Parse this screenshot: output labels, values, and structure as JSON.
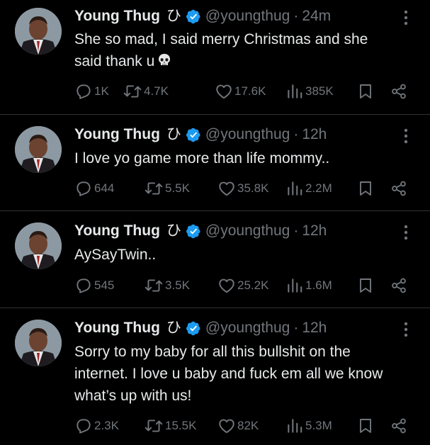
{
  "tweets": [
    {
      "name": "Young Thug",
      "name_glyph": "ひ",
      "handle": "@youngthug",
      "separator": "·",
      "time": "24m",
      "text_lines": [
        "She so mad, I said merry Christmas and she",
        "said thank u"
      ],
      "emoji": "skull-emoji",
      "replies": "1K",
      "reposts": "4.7K",
      "likes": "17.6K",
      "views": "385K"
    },
    {
      "name": "Young Thug",
      "name_glyph": "ひ",
      "handle": "@youngthug",
      "separator": "·",
      "time": "12h",
      "text_lines": [
        "I love yo game more than life mommy.."
      ],
      "replies": "644",
      "reposts": "5.5K",
      "likes": "35.8K",
      "views": "2.2M"
    },
    {
      "name": "Young Thug",
      "name_glyph": "ひ",
      "handle": "@youngthug",
      "separator": "·",
      "time": "12h",
      "text_lines": [
        "AySayTwin.."
      ],
      "replies": "545",
      "reposts": "3.5K",
      "likes": "25.2K",
      "views": "1.6M"
    },
    {
      "name": "Young Thug",
      "name_glyph": "ひ",
      "handle": "@youngthug",
      "separator": "·",
      "time": "12h",
      "text_lines": [
        "Sorry to my baby for all this bullshit on the",
        "internet. I love u baby and fuck em all we know",
        "what’s up with us!"
      ],
      "replies": "2.3K",
      "reposts": "15.5K",
      "likes": "82K",
      "views": "5.3M"
    }
  ],
  "colors": {
    "background": "#000000",
    "text": "#e7e9ea",
    "muted": "#71767b",
    "verified": "#1d9bf0",
    "divider": "#2f3336"
  },
  "icons": {
    "reply": "reply-icon",
    "repost": "repost-icon",
    "like": "heart-icon",
    "views": "views-icon",
    "bookmark": "bookmark-icon",
    "share": "share-icon",
    "more": "more-icon",
    "verified": "verified-badge-icon"
  }
}
